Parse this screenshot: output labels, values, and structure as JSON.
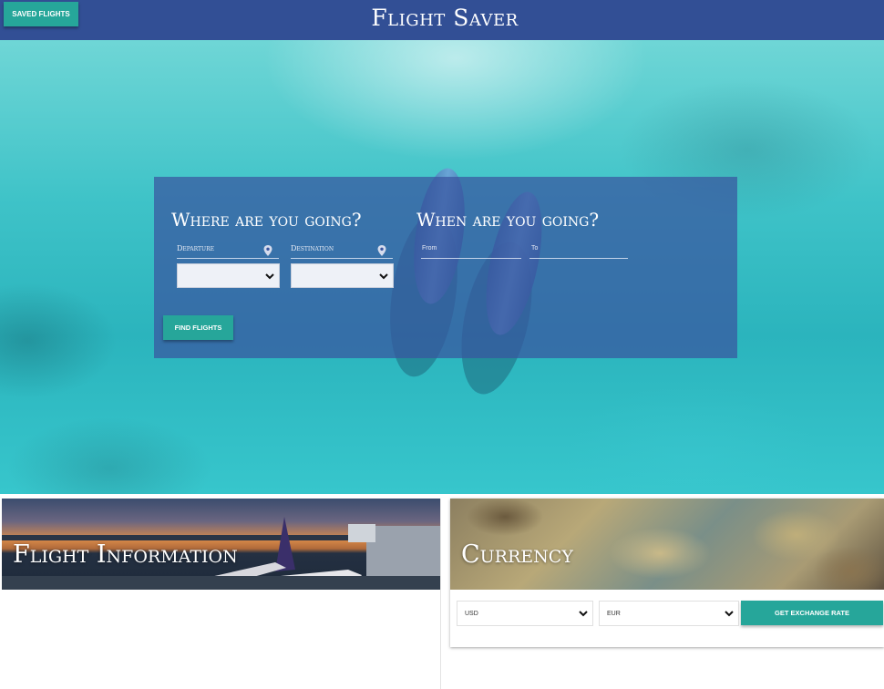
{
  "header": {
    "title": "Flight Saver",
    "saved_button": "SAVED FLIGHTS"
  },
  "search": {
    "where_heading": "Where are you going?",
    "when_heading": "When are you going?",
    "departure_label": "Departure",
    "destination_label": "Destination",
    "from_label": "From",
    "to_label": "To",
    "departure_value": "",
    "destination_value": "",
    "find_button": "FIND FLIGHTS"
  },
  "flight_info": {
    "title": "Flight Information"
  },
  "currency": {
    "title": "Currency",
    "from_currency": "USD",
    "to_currency": "EUR",
    "rate_button": "GET EXCHANGE RATE"
  },
  "colors": {
    "navbar": "#324f95",
    "accent": "#26a69a",
    "panel": "#3955a0"
  },
  "icons": [
    "location-pin-icon",
    "chevron-down-icon"
  ]
}
